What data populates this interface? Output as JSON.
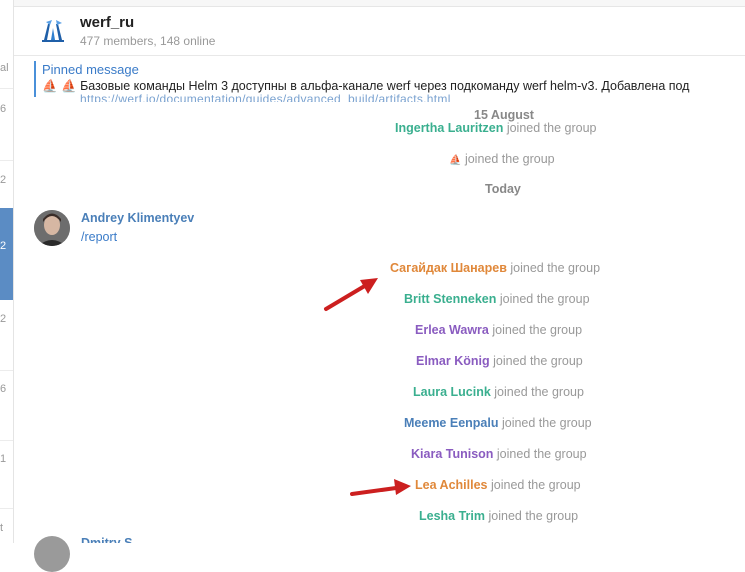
{
  "sidebar": {
    "items": [
      "al",
      "6",
      "2",
      "2",
      "2",
      "6",
      "1",
      "t"
    ]
  },
  "header": {
    "title": "werf_ru",
    "subtitle": "477 members, 148 online"
  },
  "pinned": {
    "title": "Pinned message",
    "text": "⛵ ⛵ Базовые команды Helm 3 доступны в альфа-канале werf через подкоманду werf helm-v3. Добавлена под"
  },
  "feed": {
    "cut_link": "https://werf.io/documentation/guides/advanced_build/artifacts.html",
    "date_1": "15 August",
    "e1_name": "Ingertha Lauritzen",
    "e1_action": "joined the group",
    "e2_name": "⛵",
    "e2_action": "joined the group",
    "date_2": "Today",
    "message": {
      "author": "Andrey Klimentyev",
      "text": "/report"
    },
    "joins": [
      {
        "name": "Сагайдак Шанарев",
        "action": "joined the group",
        "color": "#e0883a"
      },
      {
        "name": "Britt Stenneken",
        "action": "joined the group",
        "color": "#3aaf8f"
      },
      {
        "name": "Erlea Wawra",
        "action": "joined the group",
        "color": "#8a5cc0"
      },
      {
        "name": "Elmar König",
        "action": "joined the group",
        "color": "#8a5cc0"
      },
      {
        "name": "Laura Lucink",
        "action": "joined the group",
        "color": "#3aaf8f"
      },
      {
        "name": "Meeme Eenpalu",
        "action": "joined the group",
        "color": "#4a7fb8"
      },
      {
        "name": "Kiara Tunison",
        "action": "joined the group",
        "color": "#8a5cc0"
      },
      {
        "name": "Lea Achilles",
        "action": "joined the group",
        "color": "#e0883a"
      },
      {
        "name": "Lesha Trim",
        "action": "joined the group",
        "color": "#3aaf8f"
      }
    ],
    "bottom_author": "Dmitry S"
  },
  "colors": {
    "accent": "#3a7bc8",
    "sidebar_active": "#5b8cc4",
    "arrow": "#cc1f1f",
    "ingertha": "#3aaf8f"
  }
}
